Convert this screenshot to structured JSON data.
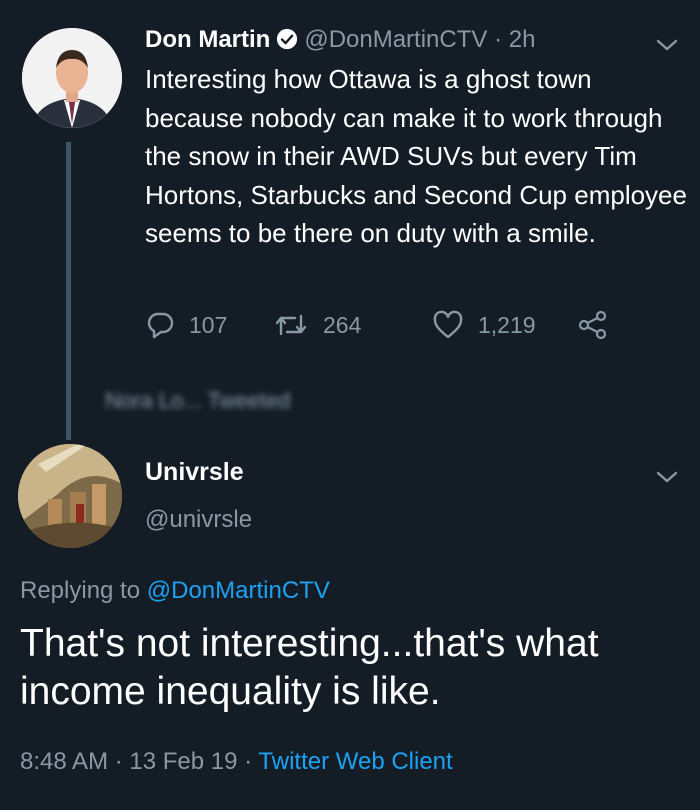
{
  "original_tweet": {
    "author_name": "Don Martin",
    "handle": "@DonMartinCTV",
    "separator": "·",
    "time": "2h",
    "text": "Interesting how Ottawa is a ghost town because nobody can make it to work through the snow in their AWD SUVs but every Tim Hortons, Starbucks and Second Cup employee seems to be there on duty with a smile.",
    "replies": "107",
    "retweets": "264",
    "likes": "1,219",
    "icons": [
      "verified-icon",
      "chevron-down-icon",
      "reply-icon",
      "retweet-icon",
      "like-icon",
      "share-icon"
    ]
  },
  "blurred_line": "Nora Lo... Tweeted",
  "reply_tweet": {
    "author_name": "Univrsle",
    "handle": "@univrsle",
    "replying_prefix": "Replying to",
    "replying_to": "@DonMartinCTV",
    "text": "That's not interesting...that's what income inequality is like.",
    "time": "8:48 AM",
    "separator": "·",
    "date": "13 Feb 19",
    "client": "Twitter Web Client"
  },
  "colors": {
    "background": "#141d26",
    "muted": "#8899a6",
    "link": "#1da1f2",
    "thread_line": "#3d5466"
  }
}
